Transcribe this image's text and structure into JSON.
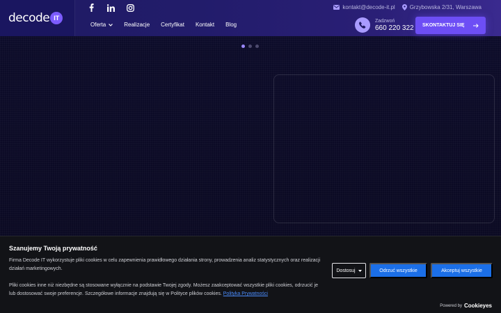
{
  "brand": {
    "logo_text": "decode",
    "logo_badge": "IT"
  },
  "header": {
    "social_icons": [
      "facebook-icon",
      "linkedin-icon",
      "instagram-icon"
    ],
    "nav": [
      {
        "label": "Oferta",
        "has_dropdown": true
      },
      {
        "label": "Realizacje"
      },
      {
        "label": "Certyfikat"
      },
      {
        "label": "Kontakt"
      },
      {
        "label": "Blog"
      }
    ],
    "email": "kontakt@decode-it.pl",
    "address": "Grzybowska 2/31, Warszawa",
    "phone_label": "Zadzwoń",
    "phone_number": "660 220 322",
    "cta_label": "SKONTAKTUJ SIĘ"
  },
  "carousel": {
    "slide_count": 3,
    "active_index": 0
  },
  "cookie": {
    "title": "Szanujemy Twoją prywatność",
    "text1": "Firma Decode IT wykorzystuje pliki cookies w celu zapewnienia prawidłowego działania strony, prowadzenia analiz statystycznych oraz realizacji działań marketingowych.",
    "text2": "Pliki cookies inne niż niezbędne są stosowane wyłącznie na podstawie Twojej zgody. Możesz zaakceptować wszystkie pliki cookies, odrzucić je lub dostosować swoje preferencje. Szczegółowe informacje znajdują się w Polityce plików cookies.",
    "link": "Polityka Prywatności",
    "btn_customize": "Dostosuj",
    "btn_reject": "Odrzuć wszystkie",
    "btn_accept": "Akceptuj wszystkie",
    "powered_by": "Powered by",
    "powered_brand": "Cookieyes"
  },
  "colors": {
    "accent": "#6d4ef5",
    "cookie_button": "#1b6fe8",
    "header_bg": "#1f1a63"
  }
}
